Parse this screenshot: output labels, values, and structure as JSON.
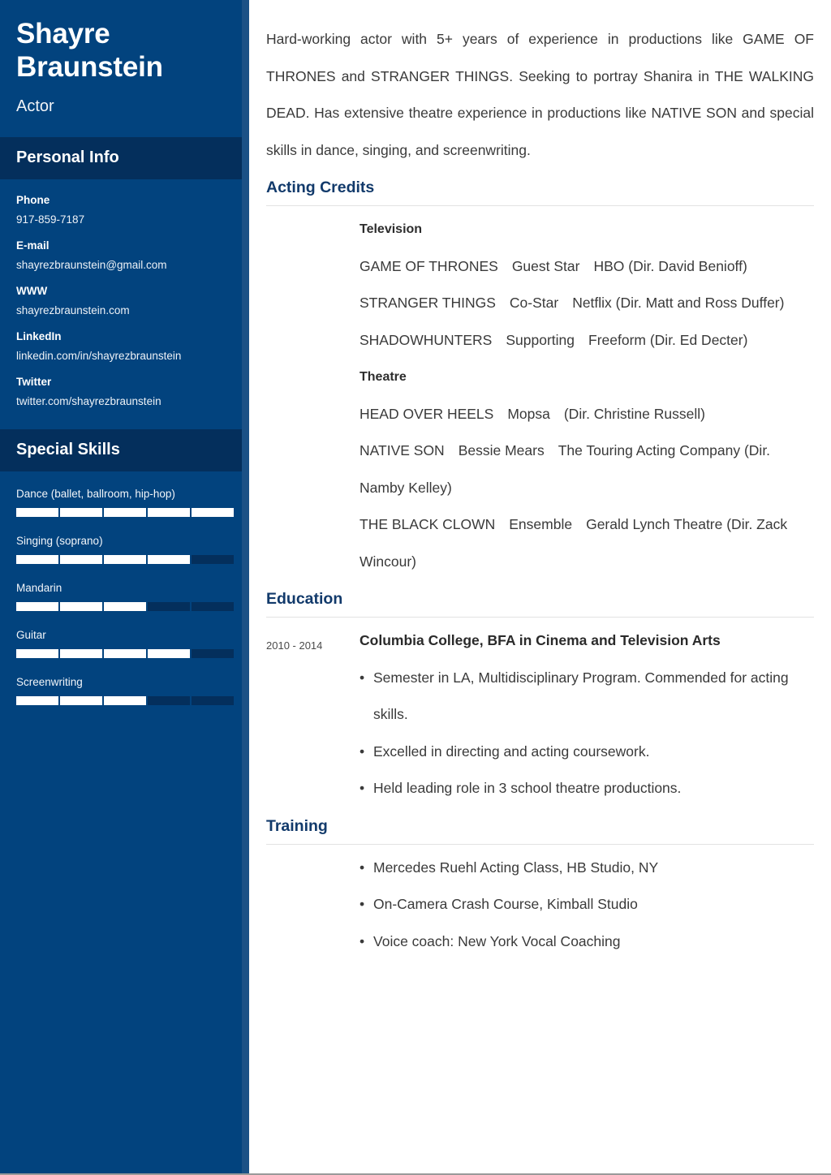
{
  "sidebar": {
    "name": "Shayre Braunstein",
    "job_title": "Actor",
    "personal_info": {
      "heading": "Personal Info",
      "items": [
        {
          "label": "Phone",
          "value": "917-859-7187"
        },
        {
          "label": "E-mail",
          "value": "shayrezbraunstein@gmail.com"
        },
        {
          "label": "WWW",
          "value": "shayrezbraunstein.com"
        },
        {
          "label": "LinkedIn",
          "value": "linkedin.com/in/shayrezbraunstein"
        },
        {
          "label": "Twitter",
          "value": "twitter.com/shayrezbraunstein"
        }
      ]
    },
    "special_skills": {
      "heading": "Special Skills",
      "items": [
        {
          "label": "Dance (ballet, ballroom, hip-hop)",
          "level": 100
        },
        {
          "label": "Singing (soprano)",
          "level": 80
        },
        {
          "label": "Mandarin",
          "level": 60
        },
        {
          "label": "Guitar",
          "level": 80
        },
        {
          "label": "Screenwriting",
          "level": 60
        }
      ]
    },
    "colors": {
      "background": "#02437e",
      "band": "#042f5c",
      "edge": "#1b5186",
      "bar_fill": "#ffffff"
    }
  },
  "main": {
    "summary": "Hard-working actor with 5+ years of experience in productions like GAME OF THRONES and STRANGER THINGS. Seeking to portray Shanira in THE WALKING DEAD. Has extensive theatre experience in productions like NATIVE SON and special skills in dance, singing, and screenwriting.",
    "acting_credits": {
      "heading": "Acting Credits",
      "groups": [
        {
          "label": "Television",
          "credits": [
            {
              "production": "GAME OF THRONES",
              "role": "Guest Star",
              "company": "HBO (Dir. David Benioff)"
            },
            {
              "production": "STRANGER THINGS",
              "role": "Co-Star",
              "company": "Netflix (Dir. Matt and Ross Duffer)"
            },
            {
              "production": "SHADOWHUNTERS",
              "role": "Supporting",
              "company": "Freeform (Dir. Ed Decter)"
            }
          ]
        },
        {
          "label": "Theatre",
          "credits": [
            {
              "production": "HEAD OVER HEELS",
              "role": "Mopsa",
              "company": "(Dir. Christine Russell)"
            },
            {
              "production": "NATIVE SON",
              "role": "Bessie Mears",
              "company": "The Touring Acting Company (Dir. Namby Kelley)"
            },
            {
              "production": "THE BLACK CLOWN",
              "role": "Ensemble",
              "company": "Gerald Lynch Theatre (Dir. Zack Wincour)"
            }
          ]
        }
      ]
    },
    "education": {
      "heading": "Education",
      "entries": [
        {
          "dates": "2010 - 2014",
          "school": "Columbia College, BFA in Cinema and Television Arts",
          "bullets": [
            "Semester in LA, Multidisciplinary Program. Commended for acting skills.",
            "Excelled in directing and acting coursework.",
            "Held leading role in 3 school theatre productions."
          ]
        }
      ]
    },
    "training": {
      "heading": "Training",
      "bullets": [
        "Mercedes Ruehl Acting Class, HB Studio, NY",
        "On-Camera Crash Course, Kimball Studio",
        "Voice coach: New York Vocal Coaching"
      ]
    },
    "colors": {
      "heading": "#123a6b",
      "body_text": "#3a3a3a",
      "rule": "#e2e2e2"
    }
  }
}
